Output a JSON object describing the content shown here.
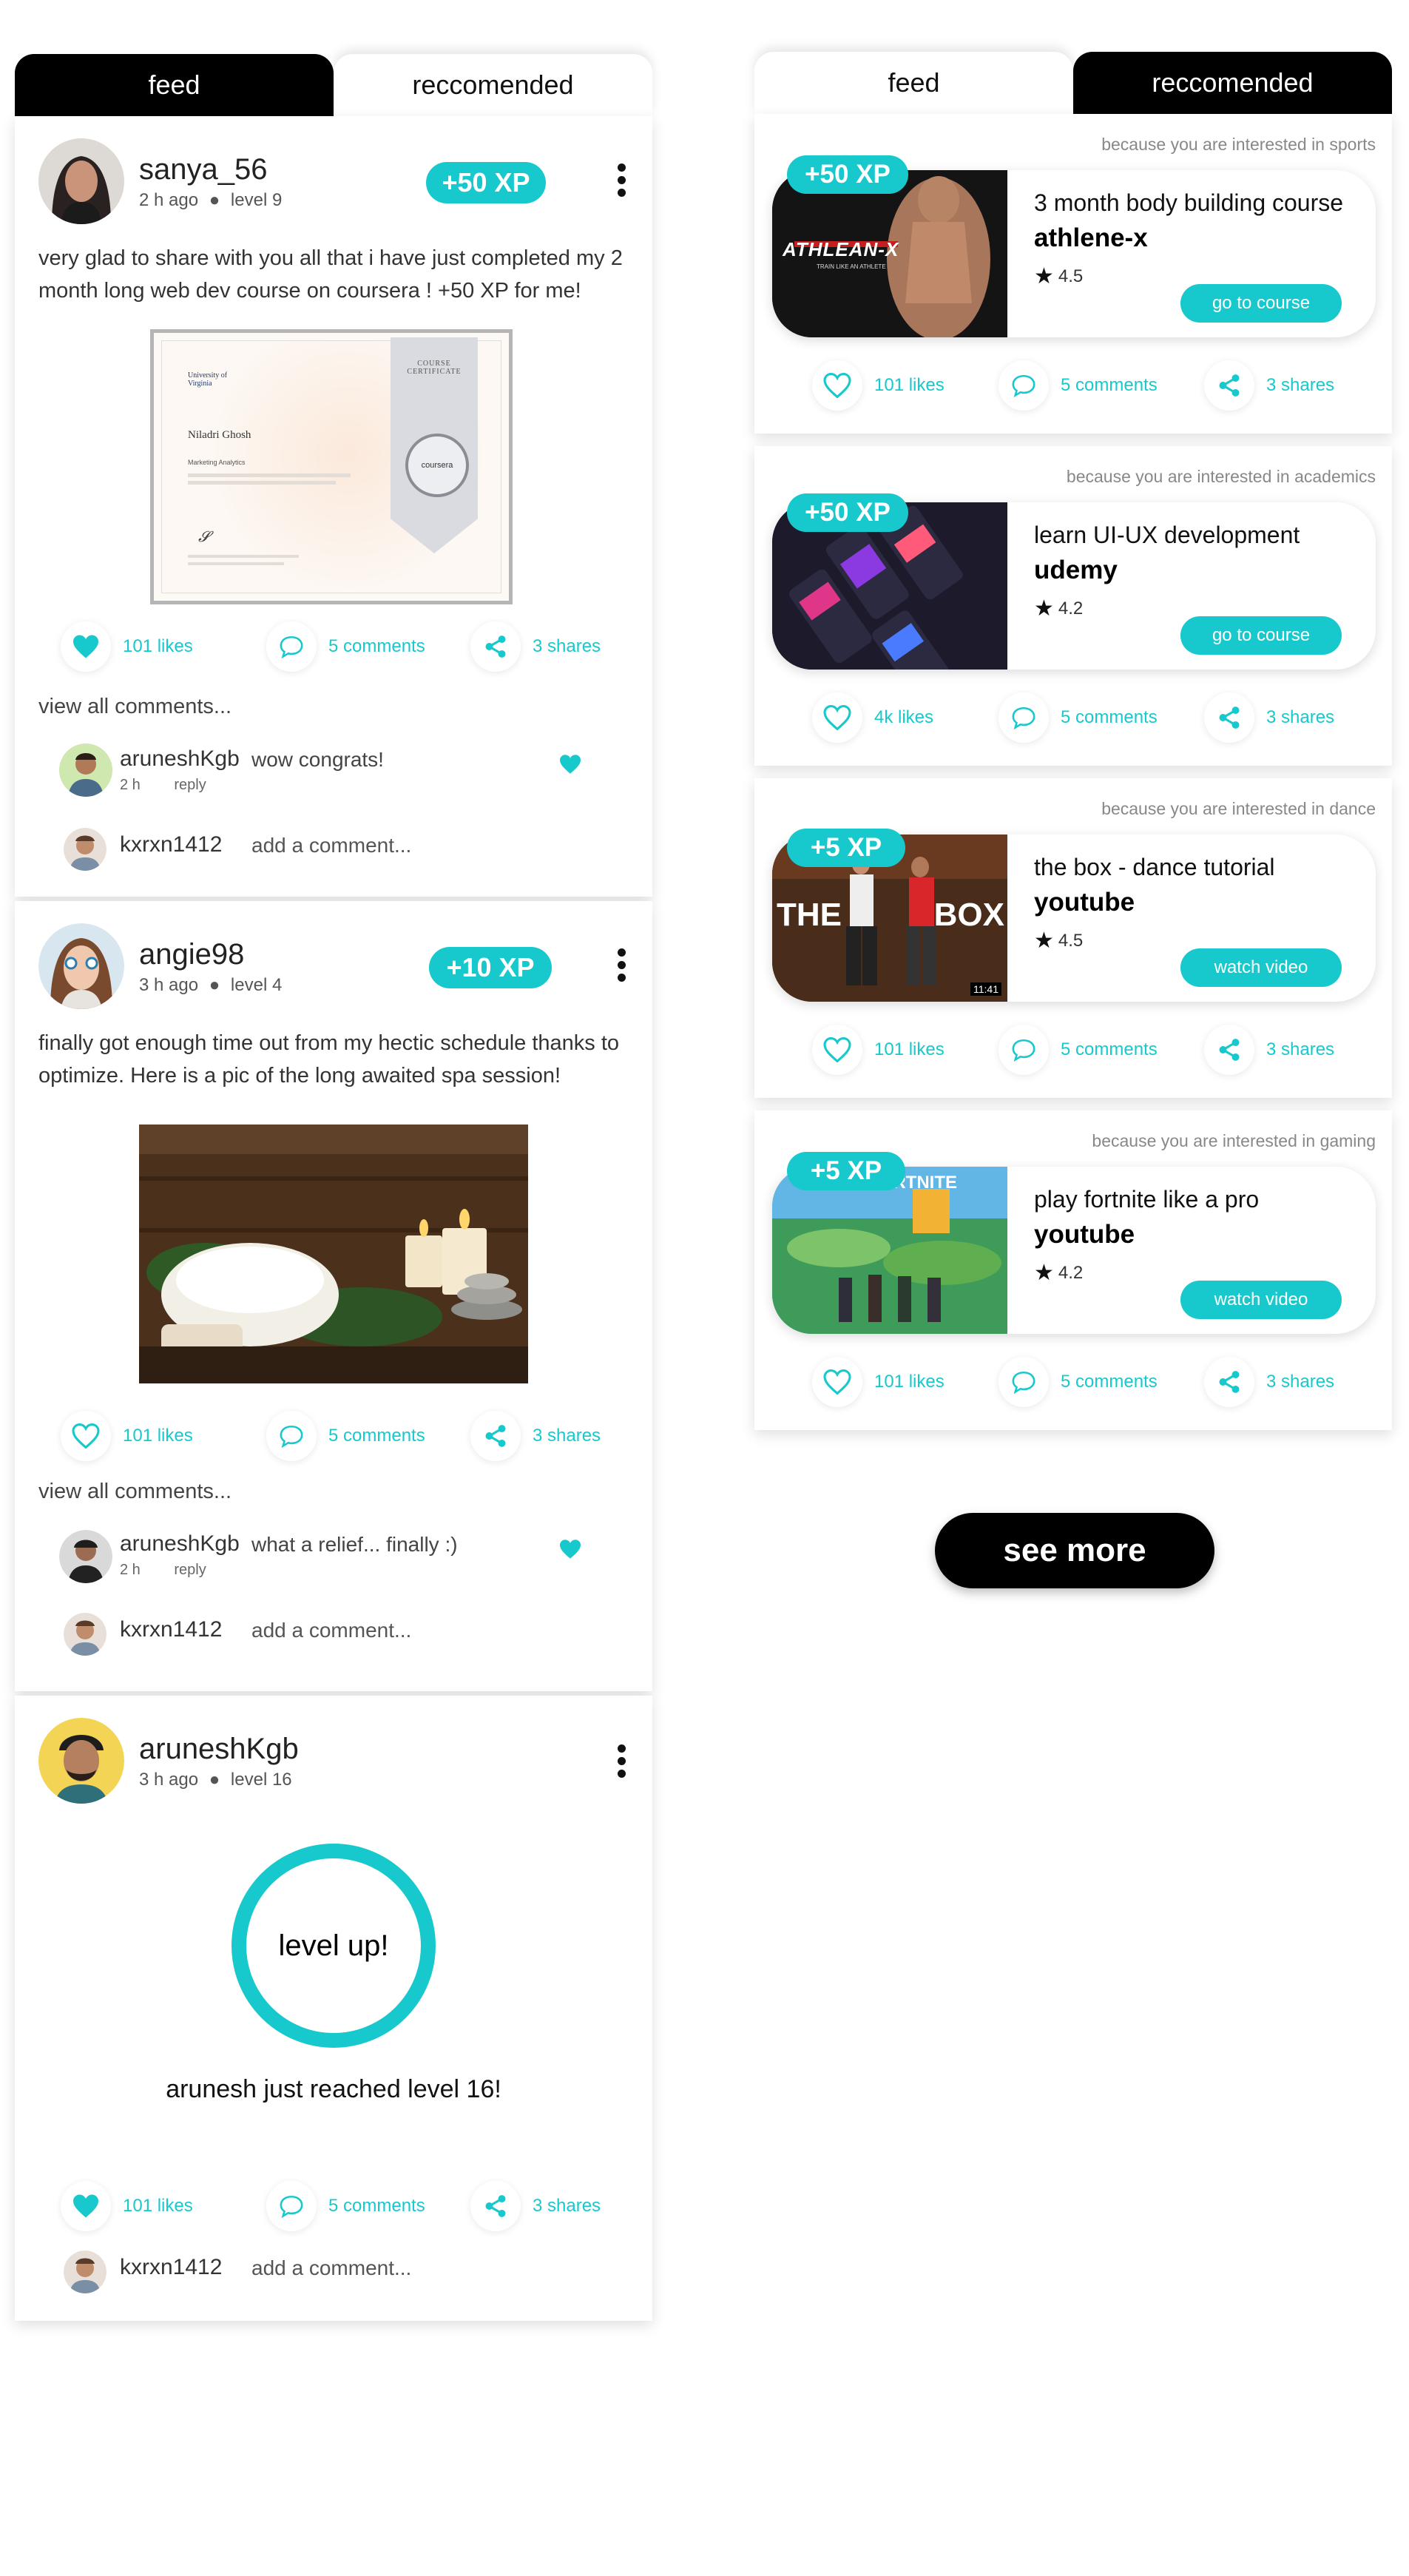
{
  "colors": {
    "accent": "#17c9cc",
    "dark": "#000000",
    "background": "#ffffff"
  },
  "left_tabs": {
    "feed": "feed",
    "recommended": "reccomended"
  },
  "right_tabs": {
    "feed": "feed",
    "recommended": "reccomended"
  },
  "posts": [
    {
      "username": "sanya_56",
      "time": "2 h ago",
      "level": "level 9",
      "xp": "+50 XP",
      "text": "very glad to share with you all that i have just completed my 2 month long web dev course on coursera ! +50 XP for me!",
      "certificate": {
        "label": "COURSE CERTIFICATE",
        "name": "Niladri Ghosh",
        "course": "Marketing Analytics",
        "university": "University of Virginia",
        "seal": "coursera"
      },
      "likes": "101 likes",
      "comments": "5 comments",
      "shares": "3 shares",
      "view_all": "view all comments...",
      "comment": {
        "user": "aruneshKgb",
        "text": "wow congrats!",
        "time": "2 h",
        "reply": "reply"
      },
      "add_comment": {
        "user": "kxrxn1412",
        "placeholder": "add a comment..."
      }
    },
    {
      "username": "angie98",
      "time": "3 h ago",
      "level": "level 4",
      "xp": "+10 XP",
      "text": "finally got enough time out from my hectic schedule thanks to optimize. Here is a pic of the long awaited spa session!",
      "likes": "101 likes",
      "comments": "5 comments",
      "shares": "3 shares",
      "view_all": "view all comments...",
      "comment": {
        "user": "aruneshKgb",
        "text": "what a relief... finally :)",
        "time": "2 h",
        "reply": "reply"
      },
      "add_comment": {
        "user": "kxrxn1412",
        "placeholder": "add a comment..."
      }
    },
    {
      "username": "aruneshKgb",
      "time": "3 h ago",
      "level": "level 16",
      "ring_text": "level up!",
      "caption": "arunesh just reached level 16!",
      "likes": "101 likes",
      "comments": "5 comments",
      "shares": "3 shares",
      "add_comment": {
        "user": "kxrxn1412",
        "placeholder": "add a comment..."
      }
    }
  ],
  "recommendations": [
    {
      "because": "because you are interested in sports",
      "xp": "+50 XP",
      "title": "3 month body building course",
      "provider": "athlene-x",
      "rating": "4.5",
      "button": "go to course",
      "likes": "101 likes",
      "comments": "5 comments",
      "shares": "3 shares",
      "thumb_text": "ATHLEAN-X",
      "thumb_sub": "TRAIN LIKE AN ATHLETE"
    },
    {
      "because": "because you are interested in academics",
      "xp": "+50 XP",
      "title": "learn UI-UX development",
      "provider": "udemy",
      "rating": "4.2",
      "button": "go to course",
      "likes": "4k likes",
      "comments": "5 comments",
      "shares": "3 shares"
    },
    {
      "because": "because you are interested in dance",
      "xp": "+5 XP",
      "title": "the box - dance tutorial",
      "provider": "youtube",
      "rating": "4.5",
      "button": "watch video",
      "likes": "101 likes",
      "comments": "5 comments",
      "shares": "3 shares",
      "thumb_left": "THE",
      "thumb_right": "BOX",
      "duration": "11:41"
    },
    {
      "because": "because you are interested in gaming",
      "xp": "+5 XP",
      "title": "play fortnite like a pro",
      "provider": "youtube",
      "rating": "4.2",
      "button": "watch video",
      "likes": "101 likes",
      "comments": "5 comments",
      "shares": "3 shares",
      "thumb_text": "FORTNITE"
    }
  ],
  "see_more": "see more",
  "icons": [
    "heart-icon",
    "comment-icon",
    "share-icon",
    "kebab-menu-icon",
    "star-icon"
  ]
}
